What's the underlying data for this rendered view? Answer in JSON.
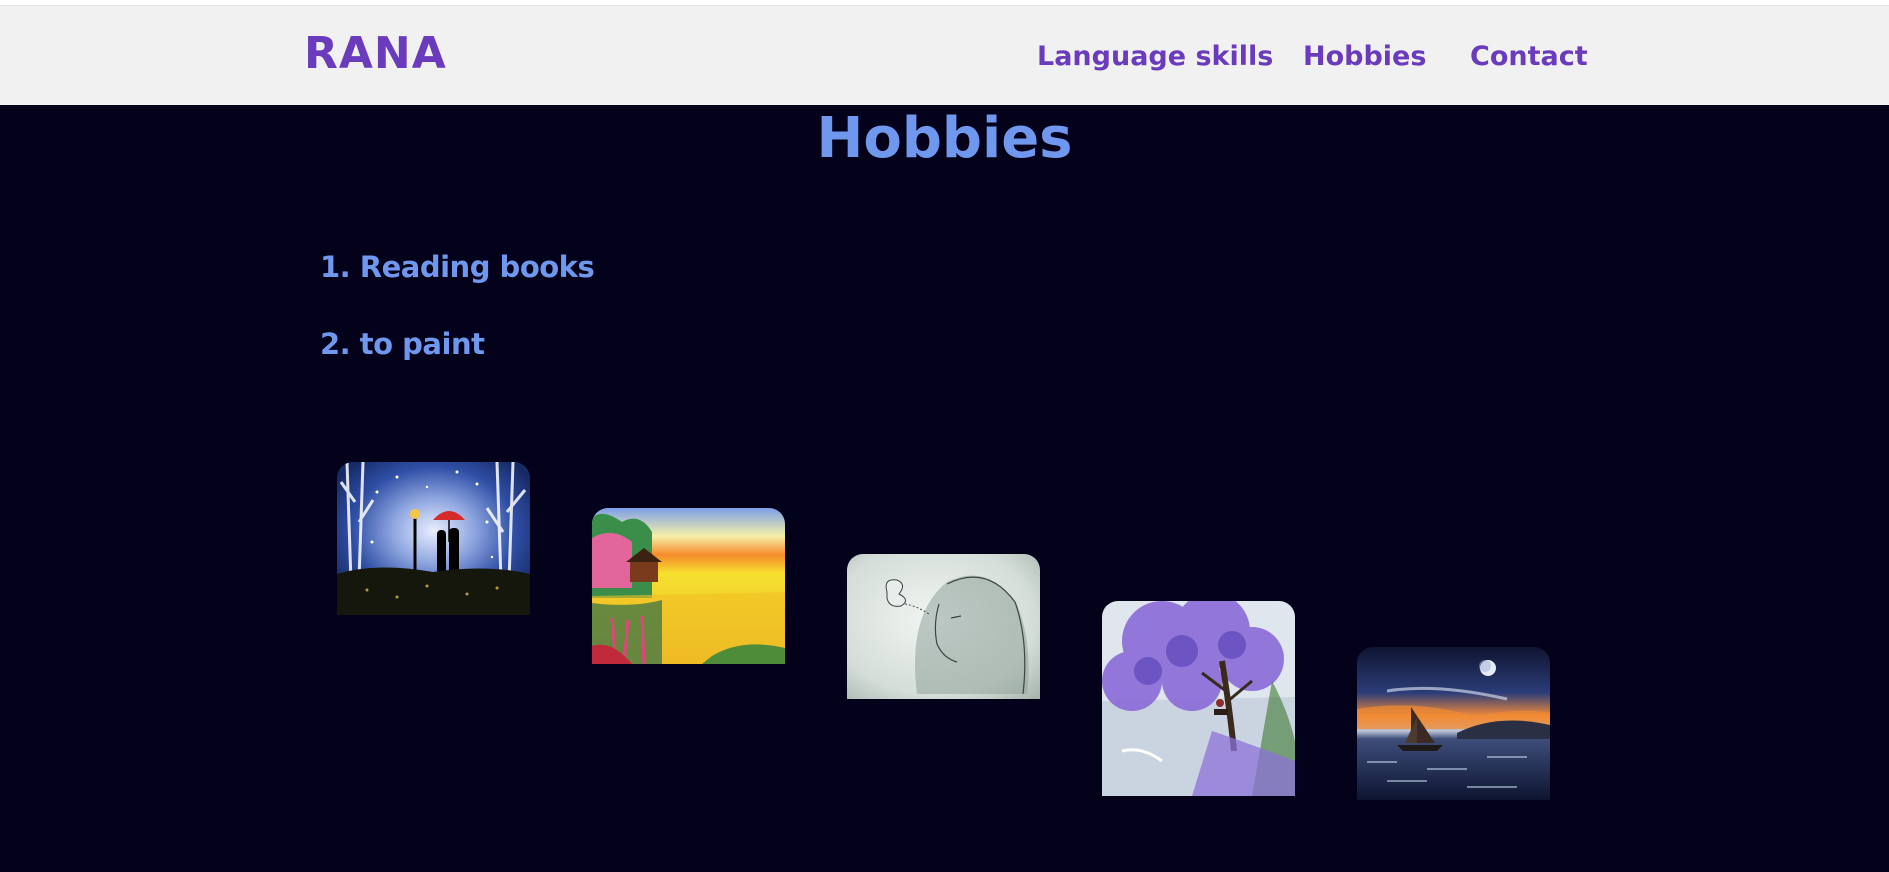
{
  "nav": {
    "brand": "RANA",
    "links": [
      {
        "label": "Language skills"
      },
      {
        "label": "Hobbies"
      },
      {
        "label": "Contact"
      }
    ]
  },
  "section": {
    "title": "Hobbies",
    "items": [
      {
        "label": "1. Reading books"
      },
      {
        "label": "2. to paint"
      }
    ]
  },
  "gallery": [
    {
      "subject": "couple-umbrella-night-painting"
    },
    {
      "subject": "sunset-lake-cottage-painting"
    },
    {
      "subject": "hooded-woman-pencil-sketch"
    },
    {
      "subject": "purple-tree-lake-painting"
    },
    {
      "subject": "sailboat-moonlit-sea-painting"
    }
  ],
  "colors": {
    "brand": "#6a3bbd",
    "heading": "#6f97ee",
    "navbar_bg": "#f1f1f1",
    "page_bg": "#03021a"
  }
}
